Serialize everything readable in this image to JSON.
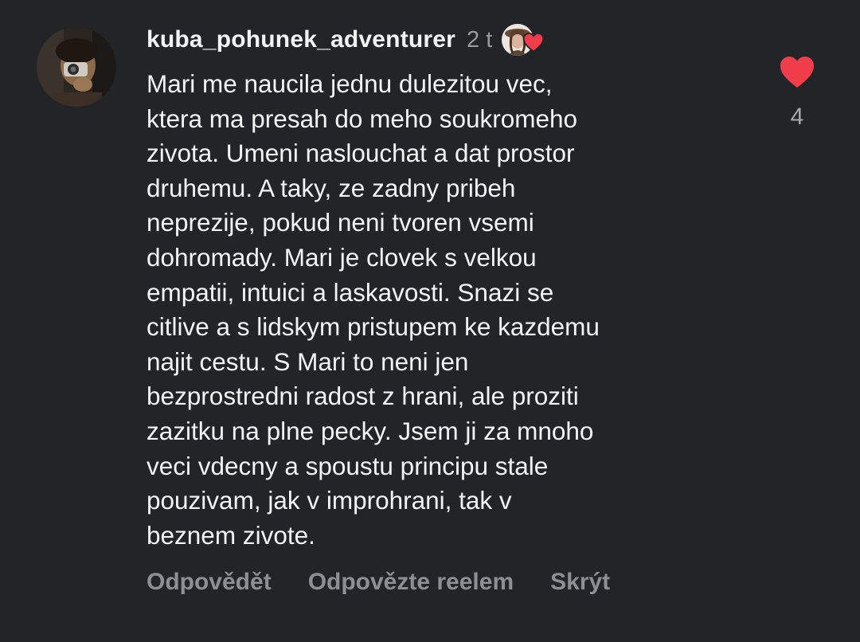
{
  "comment": {
    "username": "kuba_pohunek_adventurer",
    "time": "2 t",
    "text": "Mari me naucila jednu dulezitou vec,\nktera ma presah do meho soukromeho\nzivota. Umeni naslouchat a dat prostor\ndruhemu. A taky, ze zadny pribeh\nneprezije, pokud neni tvoren vsemi\ndohromady. Mari je clovek s velkou\nempatii, intuici  a laskavosti. Snazi se\ncitlive a s lidskym pristupem ke kazdemu\nnajit cestu. S Mari to neni jen\nbezprostredni radost z hrani, ale proziti\nzazitku na plne pecky. Jsem ji za mnoho\nveci vdecny a spoustu principu stale\npouzivam, jak v improhrani, tak v\nbeznem zivote.",
    "like_count": "4",
    "actions": {
      "reply": "Odpovědět",
      "reply_reel": "Odpovězte reelem",
      "hide": "Skrýt"
    }
  },
  "icons": {
    "like": "heart-icon",
    "creator_like": "creator-liked-heart-icon"
  },
  "colors": {
    "background": "#232428",
    "text": "#f4f4f4",
    "muted": "#8e8f94",
    "heart": "#ef3e4a"
  }
}
